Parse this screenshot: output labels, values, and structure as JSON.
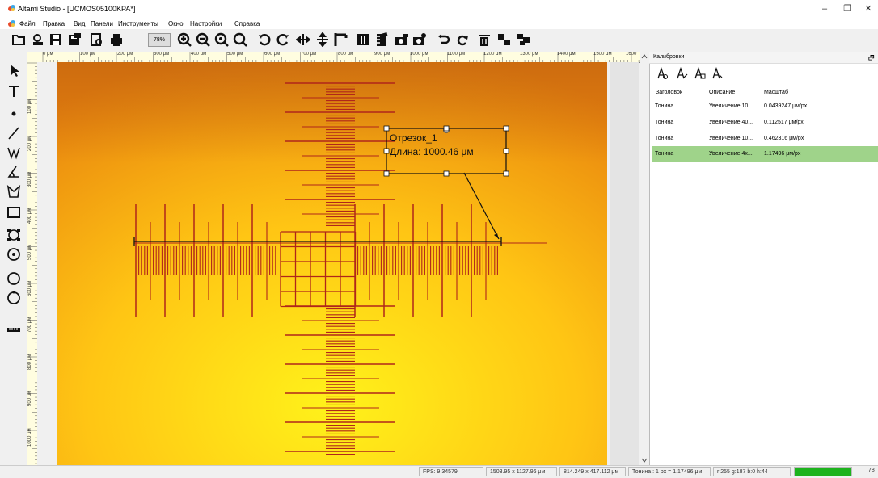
{
  "window": {
    "title": "Altami Studio - [UCMOS05100KPA*]",
    "minimize": "–",
    "restore": "❐",
    "close": "✕"
  },
  "menu": {
    "items": [
      "Файл",
      "Правка",
      "Вид",
      "Панели",
      "Инструменты",
      "Окно",
      "Настройки",
      "Справка"
    ]
  },
  "toolbar": {
    "zoom": "78%",
    "icons": [
      "open-folder-icon",
      "open-with-search-icon",
      "save-icon",
      "save-as-icon",
      "print-preview-icon",
      "print-icon",
      "zoom-in-icon",
      "zoom-out-icon",
      "zoom-fit-icon",
      "zoom-reset-icon",
      "rotate-left-icon",
      "rotate-right-icon",
      "flip-horizontal-icon",
      "flip-vertical-icon",
      "crop-icon",
      "live-view-icon",
      "film-icon",
      "camera-icon",
      "camera-settings-icon",
      "undo-icon",
      "redo-icon",
      "delete-icon",
      "copy-layers-icon",
      "paste-layers-icon"
    ]
  },
  "left_tools": [
    "pointer-icon",
    "text-icon",
    "point-icon",
    "line-icon",
    "polyline-icon",
    "angle-icon",
    "polygon-icon",
    "rectangle-icon",
    "ellipse-select-icon",
    "circle-center-icon",
    "circle-icon",
    "circle-3pt-icon",
    "scale-bar-icon"
  ],
  "ruler": {
    "h_labels": [
      "0 μм",
      "100 μм",
      "200 μм",
      "300 μм",
      "400 μм",
      "500 μм",
      "600 μм",
      "700 μм",
      "800 μм",
      "900 μм",
      "1000 μм",
      "1100 μм",
      "1200 μм",
      "1300 μм",
      "1400 μм",
      "1500 μм",
      "1600"
    ],
    "v_labels": [
      "100 μм",
      "200 μм",
      "300 μм",
      "400 μм",
      "500 μм",
      "600 μм",
      "700 μм",
      "800 μм",
      "900 μм",
      "1000 μм"
    ]
  },
  "annotation": {
    "name": "Отрезок_1",
    "length": "Длина: 1000.46 μм"
  },
  "calibration_panel": {
    "title": "Калибровки",
    "columns": [
      "Заголовок",
      "Описание",
      "Масштаб"
    ],
    "rows": [
      {
        "title": "Тонина",
        "desc": "Увеличение 10...",
        "scale": "0.0439247 μм/px",
        "selected": false
      },
      {
        "title": "Тонина",
        "desc": "Увеличение 40...",
        "scale": "0.112517 μм/px",
        "selected": false
      },
      {
        "title": "Тонина",
        "desc": "Увеличение 10...",
        "scale": "0.462316 μм/px",
        "selected": false
      },
      {
        "title": "Тонина",
        "desc": "Увеличение 4х...",
        "scale": "1.17496 μм/px",
        "selected": true
      }
    ],
    "selected_color": "#9fd38a"
  },
  "status": {
    "fps": "FPS: 9.34579",
    "image_size": "1503.95 x 1127.96 μм",
    "cursor": "814.249 x 417.112 μм",
    "calibration": "Тонина : 1 px = 1.17496 μм",
    "color": "r:255 g:187 b:0 h:44",
    "indicator_color": "#1db31d",
    "trailing": "78"
  }
}
